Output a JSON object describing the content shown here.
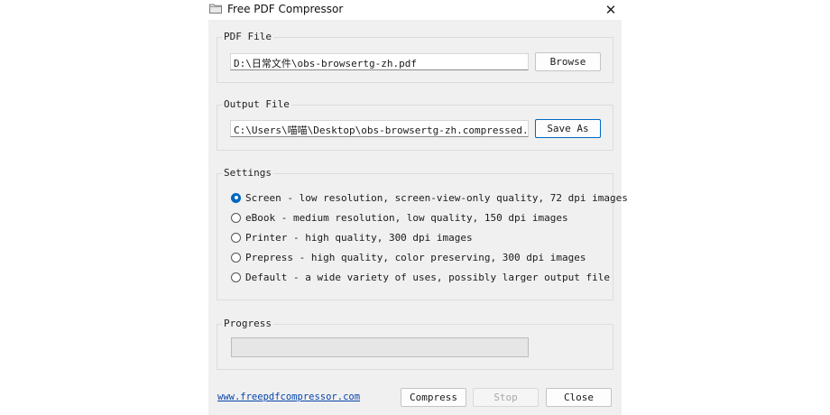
{
  "window": {
    "title": "Free PDF Compressor",
    "icon": "folder-icon",
    "close_glyph": "✕"
  },
  "pdf_file": {
    "label": "PDF File",
    "value": "D:\\日常文件\\obs-browsertg-zh.pdf",
    "button_label": "Browse"
  },
  "output_file": {
    "label": "Output File",
    "value": "C:\\Users\\喵喵\\Desktop\\obs-browsertg-zh.compressed.pdf",
    "button_label": "Save As"
  },
  "settings": {
    "label": "Settings",
    "selected_index": 0,
    "options": [
      {
        "label": "Screen - low resolution, screen-view-only quality, 72 dpi images",
        "selected": true
      },
      {
        "label": "eBook - medium resolution, low quality, 150 dpi images",
        "selected": false
      },
      {
        "label": "Printer - high quality, 300 dpi images",
        "selected": false
      },
      {
        "label": "Prepress - high quality, color preserving, 300 dpi images",
        "selected": false
      },
      {
        "label": "Default - a wide variety of uses, possibly larger output file",
        "selected": false
      }
    ]
  },
  "progress": {
    "label": "Progress",
    "value_percent": 0
  },
  "footer": {
    "link_text": "www.freepdfcompressor.com",
    "compress_label": "Compress",
    "stop_label": "Stop",
    "close_label": "Close"
  },
  "colors": {
    "accent": "#0067c0",
    "link": "#0645ad",
    "progress_fill": "#06b025",
    "window_bg": "#f0f0f0"
  }
}
